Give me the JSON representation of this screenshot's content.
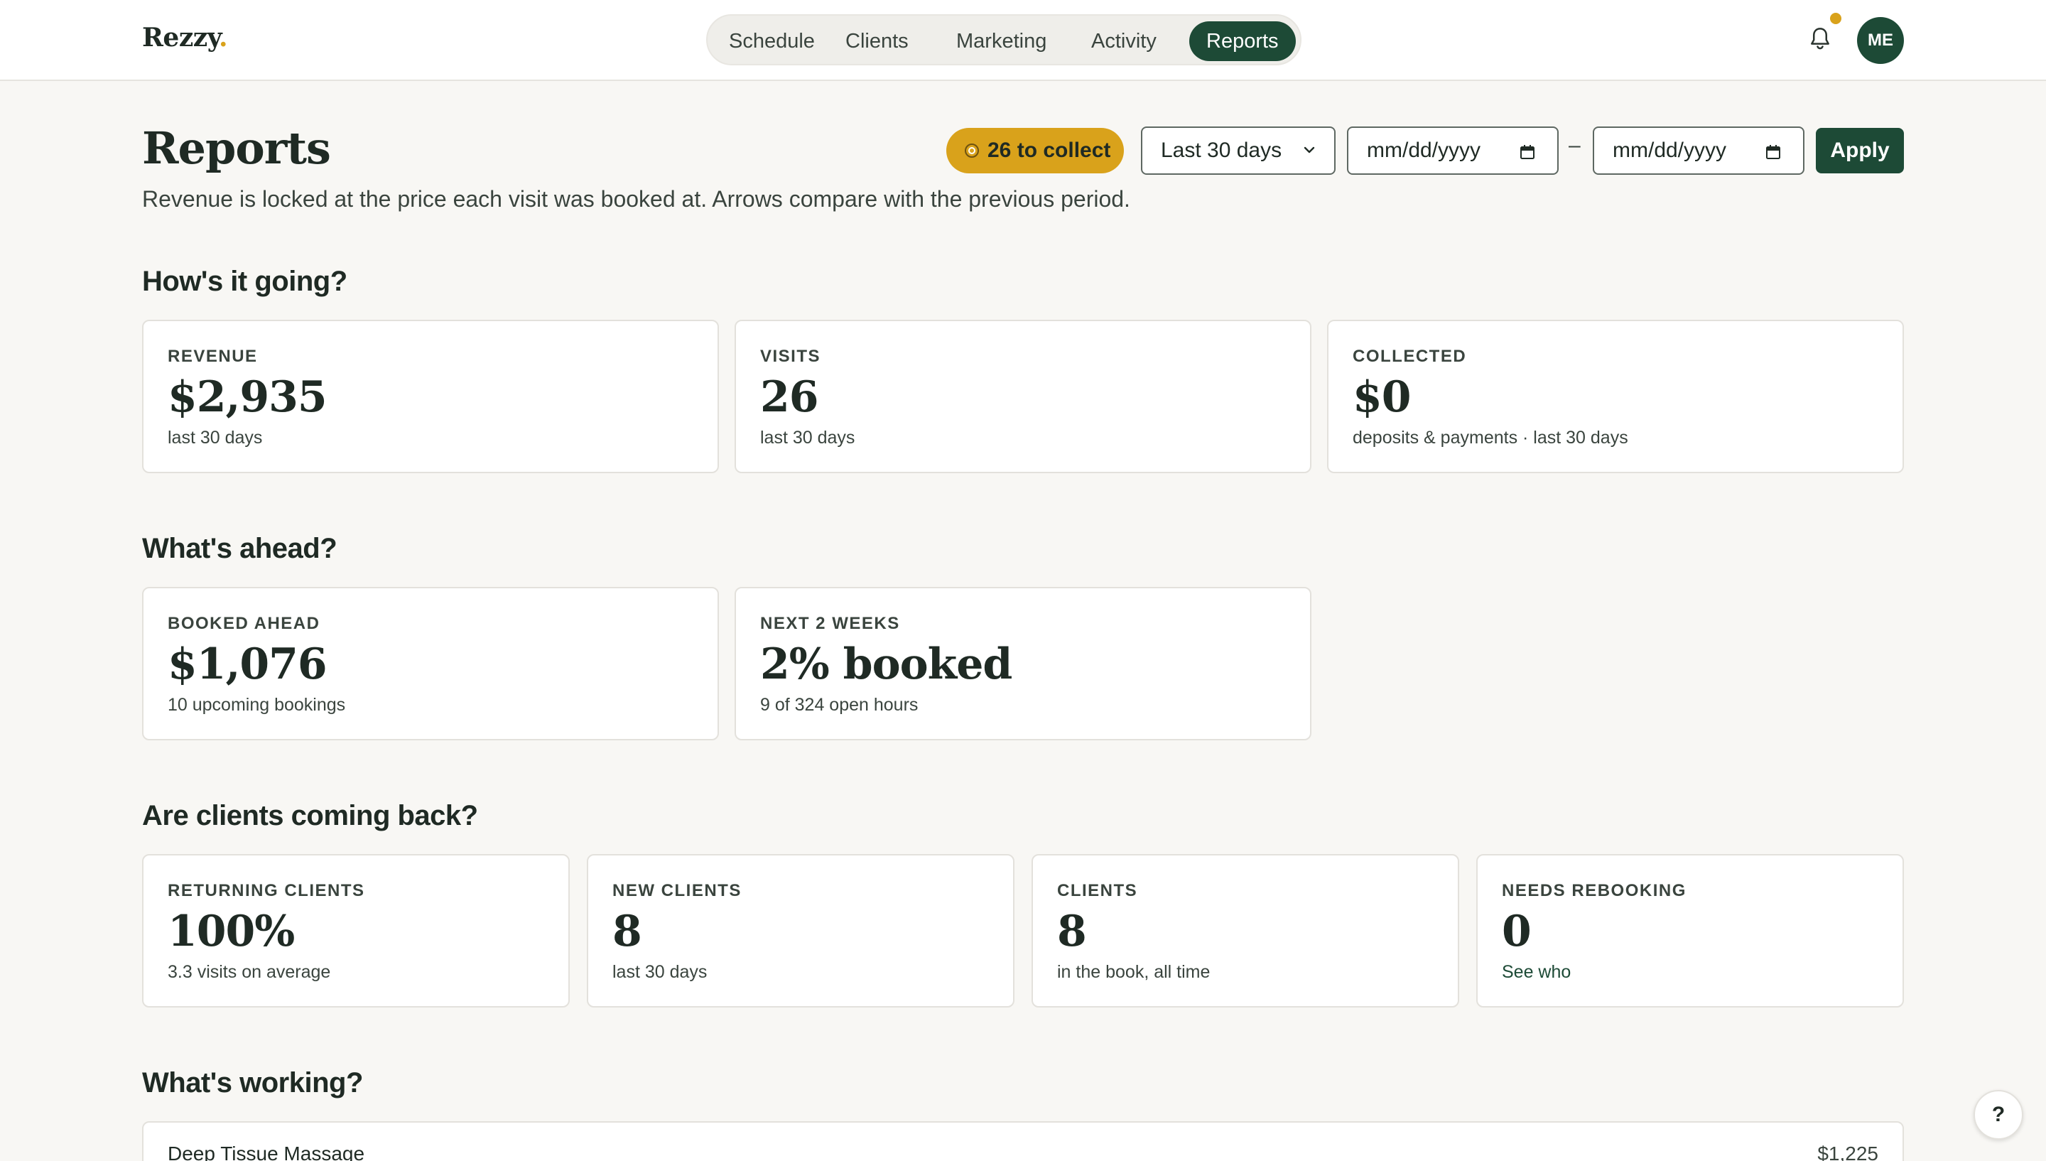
{
  "brand": {
    "name": "Rezzy",
    "dot": "."
  },
  "nav": {
    "items": [
      {
        "label": "Schedule"
      },
      {
        "label": "Clients"
      },
      {
        "label": "Marketing"
      },
      {
        "label": "Activity"
      },
      {
        "label": "Reports",
        "active": true
      }
    ]
  },
  "user": {
    "initials": "ME"
  },
  "header": {
    "title": "Reports",
    "subtitle": "Revenue is locked at the price each visit was booked at. Arrows compare with the previous period.",
    "collect_label": "26 to collect",
    "range_value": "Last 30 days",
    "date_from_placeholder": "mm/dd/yyyy",
    "date_to_placeholder": "mm/dd/yyyy",
    "dash": "–",
    "apply_label": "Apply"
  },
  "sections": {
    "going": {
      "title": "How's it going?",
      "cards": [
        {
          "label": "REVENUE",
          "value": "$2,935",
          "note": "last 30 days"
        },
        {
          "label": "VISITS",
          "value": "26",
          "note": "last 30 days"
        },
        {
          "label": "COLLECTED",
          "value": "$0",
          "note": "deposits & payments · last 30 days"
        }
      ]
    },
    "ahead": {
      "title": "What's ahead?",
      "cards": [
        {
          "label": "BOOKED AHEAD",
          "value": "$1,076",
          "note": "10 upcoming bookings"
        },
        {
          "label": "NEXT 2 WEEKS",
          "value": "2% booked",
          "note": "9 of 324 open hours"
        }
      ]
    },
    "back": {
      "title": "Are clients coming back?",
      "cards": [
        {
          "label": "RETURNING CLIENTS",
          "value": "100%",
          "note": "3.3 visits on average"
        },
        {
          "label": "NEW CLIENTS",
          "value": "8",
          "note": "last 30 days"
        },
        {
          "label": "CLIENTS",
          "value": "8",
          "note": "in the book, all time"
        },
        {
          "label": "NEEDS REBOOKING",
          "value": "0",
          "note": "See who"
        }
      ]
    },
    "working": {
      "title": "What's working?",
      "rows": [
        {
          "name": "Deep Tissue Massage",
          "amount": "$1,225"
        }
      ]
    }
  },
  "help": {
    "label": "?"
  },
  "colors": {
    "primary": "#1d4a36",
    "accent": "#d9a21b",
    "background": "#f8f7f4"
  }
}
